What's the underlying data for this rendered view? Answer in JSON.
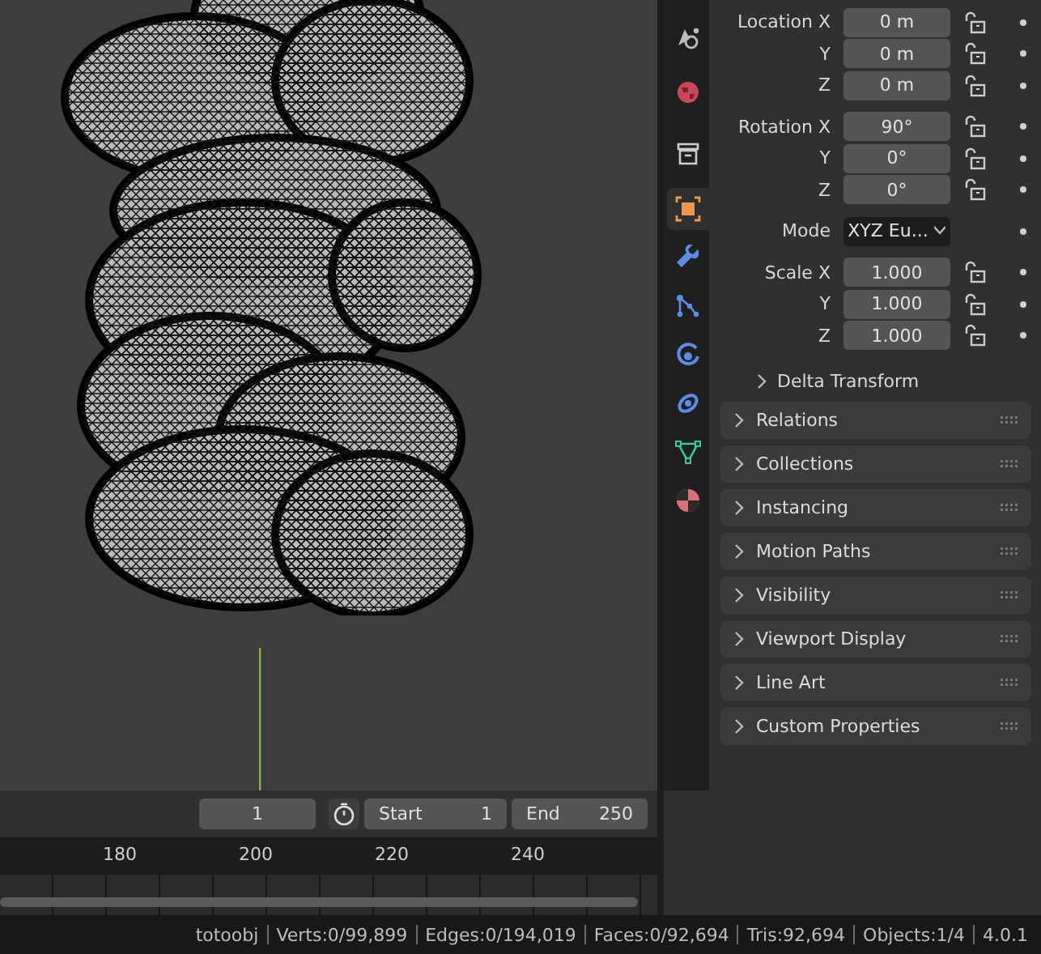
{
  "properties_tabs": [
    {
      "kind": "physics-scene",
      "selected": false
    },
    {
      "kind": "world",
      "selected": false
    },
    {
      "kind": "collection",
      "selected": false
    },
    {
      "kind": "object",
      "selected": true
    },
    {
      "kind": "modifier",
      "selected": false
    },
    {
      "kind": "particles",
      "selected": false
    },
    {
      "kind": "physics",
      "selected": false
    },
    {
      "kind": "constraint",
      "selected": false
    },
    {
      "kind": "data",
      "selected": false
    },
    {
      "kind": "material",
      "selected": false
    }
  ],
  "transform": {
    "groups": [
      [
        {
          "label": "Location X",
          "value": "0 m",
          "kind": "number"
        },
        {
          "label": "Y",
          "value": "0 m",
          "kind": "number"
        },
        {
          "label": "Z",
          "value": "0 m",
          "kind": "number"
        }
      ],
      [
        {
          "label": "Rotation X",
          "value": "90°",
          "kind": "number"
        },
        {
          "label": "Y",
          "value": "0°",
          "kind": "number"
        },
        {
          "label": "Z",
          "value": "0°",
          "kind": "number"
        }
      ],
      [
        {
          "label": "Mode",
          "value": "XYZ Eu...",
          "kind": "dropdown"
        }
      ],
      [
        {
          "label": "Scale X",
          "value": "1.000",
          "kind": "number"
        },
        {
          "label": "Y",
          "value": "1.000",
          "kind": "number"
        },
        {
          "label": "Z",
          "value": "1.000",
          "kind": "number"
        }
      ]
    ],
    "subpanel": {
      "label": "Delta Transform",
      "expanded": false
    }
  },
  "panels": [
    {
      "label": "Relations",
      "expanded": false
    },
    {
      "label": "Collections",
      "expanded": false
    },
    {
      "label": "Instancing",
      "expanded": false
    },
    {
      "label": "Motion Paths",
      "expanded": false
    },
    {
      "label": "Visibility",
      "expanded": false
    },
    {
      "label": "Viewport Display",
      "expanded": false
    },
    {
      "label": "Line Art",
      "expanded": false
    },
    {
      "label": "Custom Properties",
      "expanded": false
    }
  ],
  "timeline": {
    "current_frame": "1",
    "start_label": "Start",
    "start": "1",
    "end_label": "End",
    "end": "250",
    "ticks": [
      "180",
      "200",
      "220",
      "240"
    ]
  },
  "status_bar": [
    "totoobj",
    "Verts:0/99,899",
    "Edges:0/194,019",
    "Faces:0/92,694",
    "Tris:92,694",
    "Objects:1/4",
    "4.0.1"
  ]
}
